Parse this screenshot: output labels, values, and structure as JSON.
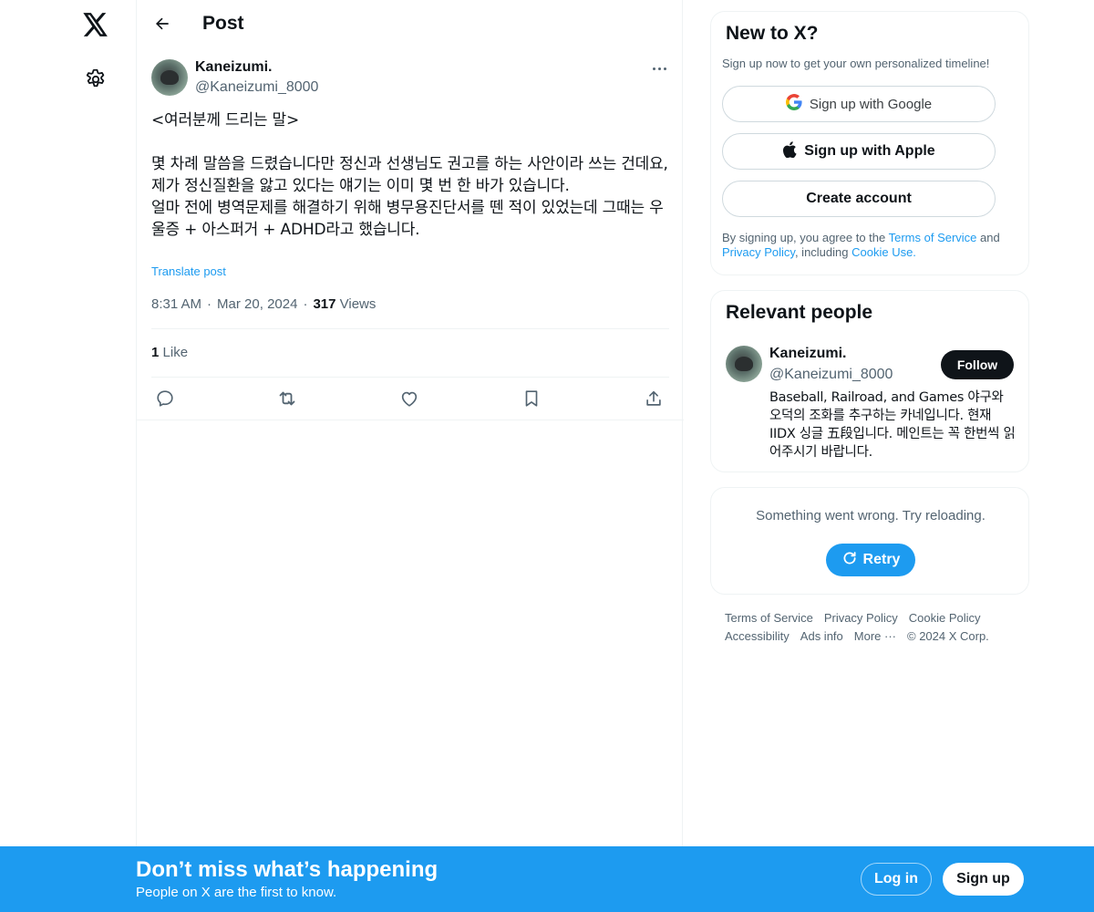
{
  "nav": {
    "logo_icon": "x-logo-icon",
    "settings_icon": "gear-icon"
  },
  "header": {
    "title": "Post",
    "back_icon": "arrow-left-icon"
  },
  "post": {
    "author_name": "Kaneizumi.",
    "author_handle": "@Kaneizumi_8000",
    "text": "<여러분께 드리는 말>\n\n몇 차례 말씀을 드렸습니다만 정신과 선생님도 권고를 하는 사안이라 쓰는 건데요,\n제가 정신질환을 앓고 있다는 얘기는 이미 몇 번 한 바가 있습니다.\n얼마 전에 병역문제를 해결하기 위해 병무용진단서를 뗀 적이 있었는데 그때는 우울증 + 아스퍼거 + ADHD라고 했습니다.",
    "translate_label": "Translate post",
    "time": "8:31 AM",
    "date": "Mar 20, 2024",
    "separator": "·",
    "views_count": "317",
    "views_label": "Views",
    "likes_count": "1",
    "likes_label": "Like",
    "actions": [
      "reply-icon",
      "repost-icon",
      "like-icon",
      "bookmark-icon",
      "share-icon"
    ]
  },
  "signup_card": {
    "title": "New to X?",
    "subtitle": "Sign up now to get your own personalized timeline!",
    "google_label": "Sign up with Google",
    "apple_label": "Sign up with Apple",
    "create_label": "Create account",
    "legal_prefix": "By signing up, you agree to the ",
    "terms_link": "Terms of Service",
    "legal_and": " and ",
    "privacy_link": "Privacy Policy",
    "legal_including": ", including ",
    "cookie_link": "Cookie Use."
  },
  "relevant": {
    "title": "Relevant people",
    "name": "Kaneizumi.",
    "handle": "@Kaneizumi_8000",
    "follow_label": "Follow",
    "bio": "Baseball, Railroad, and Games 야구와 오덕의 조화를 추구하는 카네입니다. 현재 IIDX 싱글 五段입니다. 메인트는 꼭 한번씩 읽어주시기 바랍니다."
  },
  "error_card": {
    "message": "Something went wrong. Try reloading.",
    "retry_label": "Retry"
  },
  "footer": {
    "terms": "Terms of Service",
    "privacy": "Privacy Policy",
    "cookie": "Cookie Policy",
    "accessibility": "Accessibility",
    "ads": "Ads info",
    "more": "More ···",
    "copyright": "© 2024 X Corp."
  },
  "banner": {
    "title": "Don’t miss what’s happening",
    "subtitle": "People on X are the first to know.",
    "login_label": "Log in",
    "signup_label": "Sign up"
  },
  "colors": {
    "accent": "#1d9bf0",
    "text": "#0f1419",
    "muted": "#536471"
  }
}
